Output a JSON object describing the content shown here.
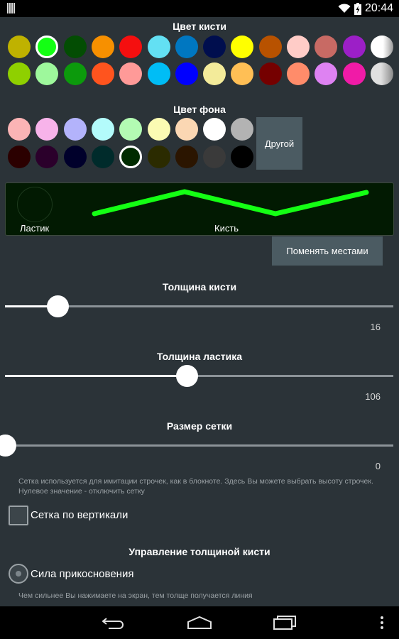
{
  "status_bar": {
    "time": "20:44",
    "icons": [
      "notification-icon",
      "wifi-icon",
      "battery-charging-icon"
    ]
  },
  "brush_color": {
    "title": "Цвет кисти",
    "row1": [
      "#bfb200",
      "#14ff14",
      "#034d03",
      "#f79000",
      "#f50f0f",
      "#63e0f3",
      "#0077c1",
      "#000e4e",
      "#ffff00",
      "#b85200",
      "#ffccc7",
      "#c86a64",
      "#9c1fc7",
      "#ffffff"
    ],
    "row2": [
      "#8fd000",
      "#9ef89c",
      "#0c9a0c",
      "#ff541e",
      "#ff9a98",
      "#00bdf6",
      "#0000ff",
      "#f3eb9a",
      "#ffbf55",
      "#750000",
      "#ff8c6a",
      "#de82f2",
      "#f01ba7",
      "#cfcfcf"
    ],
    "selected_index": 1
  },
  "background_color": {
    "title": "Цвет фона",
    "row1": [
      "#fbb4b5",
      "#f7b3ea",
      "#b3b3fb",
      "#b3fbfb",
      "#b3fbb3",
      "#fbfbb3",
      "#fbd7b3",
      "#ffffff",
      "#b3b3b3"
    ],
    "row2": [
      "#2b0000",
      "#2b002b",
      "#00002b",
      "#002b2b",
      "#002b00",
      "#2b2b00",
      "#2b1500",
      "#3a3a3a",
      "#000000"
    ],
    "selected_row": 2,
    "selected_index": 4,
    "other_button": "Другой"
  },
  "preview": {
    "eraser_label": "Ластик",
    "brush_label": "Кисть",
    "brush_color": "#14ff14",
    "swap_button": "Поменять местами"
  },
  "brush_thickness": {
    "title": "Толщина кисти",
    "value": "16",
    "fraction": 0.135
  },
  "eraser_thickness": {
    "title": "Толщина ластика",
    "value": "106",
    "fraction": 0.468
  },
  "grid_size": {
    "title": "Размер сетки",
    "value": "0",
    "fraction": 0.0,
    "hint": "Сетка используется для имитации строчек, как в блокноте. Здесь Вы можете выбрать высоту строчек. Нулевое значение - отключить сетку"
  },
  "vertical_grid": {
    "label": "Сетка по вертикали",
    "checked": false
  },
  "brush_control": {
    "title": "Управление толщиной кисти",
    "option_label": "Сила прикосновения",
    "hint": "Чем сильнее Вы нажимаете на экран, тем толще получается линия"
  },
  "nav_bar": {
    "icons": [
      "back-icon",
      "home-icon",
      "recent-apps-icon",
      "menu-icon"
    ]
  }
}
